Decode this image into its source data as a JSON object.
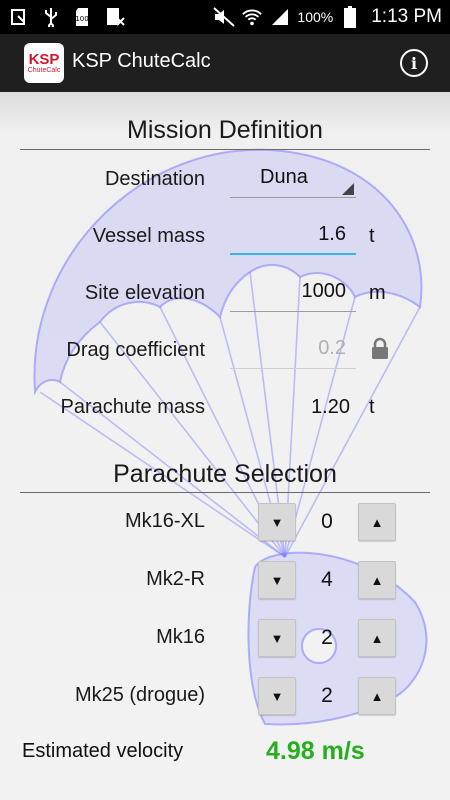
{
  "status_bar": {
    "battery_percent": "100%",
    "time": "1:13 PM"
  },
  "action_bar": {
    "logo_line1": "KSP",
    "logo_line2": "ChuteCalc",
    "title": "KSP ChuteCalc",
    "info_icon": "info-icon"
  },
  "mission": {
    "title": "Mission Definition",
    "destination": {
      "label": "Destination",
      "value": "Duna"
    },
    "vessel_mass": {
      "label": "Vessel mass",
      "value": "1.6",
      "unit": "t"
    },
    "site_elevation": {
      "label": "Site elevation",
      "value": "1000",
      "unit": "m"
    },
    "drag_coefficient": {
      "label": "Drag coefficient",
      "value": "0.2",
      "icon": "lock-icon"
    },
    "parachute_mass": {
      "label": "Parachute mass",
      "value": "1.20",
      "unit": "t"
    }
  },
  "selection": {
    "title": "Parachute Selection",
    "items": [
      {
        "label": "Mk16-XL",
        "count": "0"
      },
      {
        "label": "Mk2-R",
        "count": "4"
      },
      {
        "label": "Mk16",
        "count": "2"
      },
      {
        "label": "Mk25 (drogue)",
        "count": "2"
      }
    ],
    "down_glyph": "▼",
    "up_glyph": "▲"
  },
  "result": {
    "label": "Estimated velocity",
    "value": "4.98 m/s"
  },
  "colors": {
    "accent_focus": "#33b5e5",
    "velocity_green": "#27ae1f",
    "watermark": "#7b7bff"
  }
}
